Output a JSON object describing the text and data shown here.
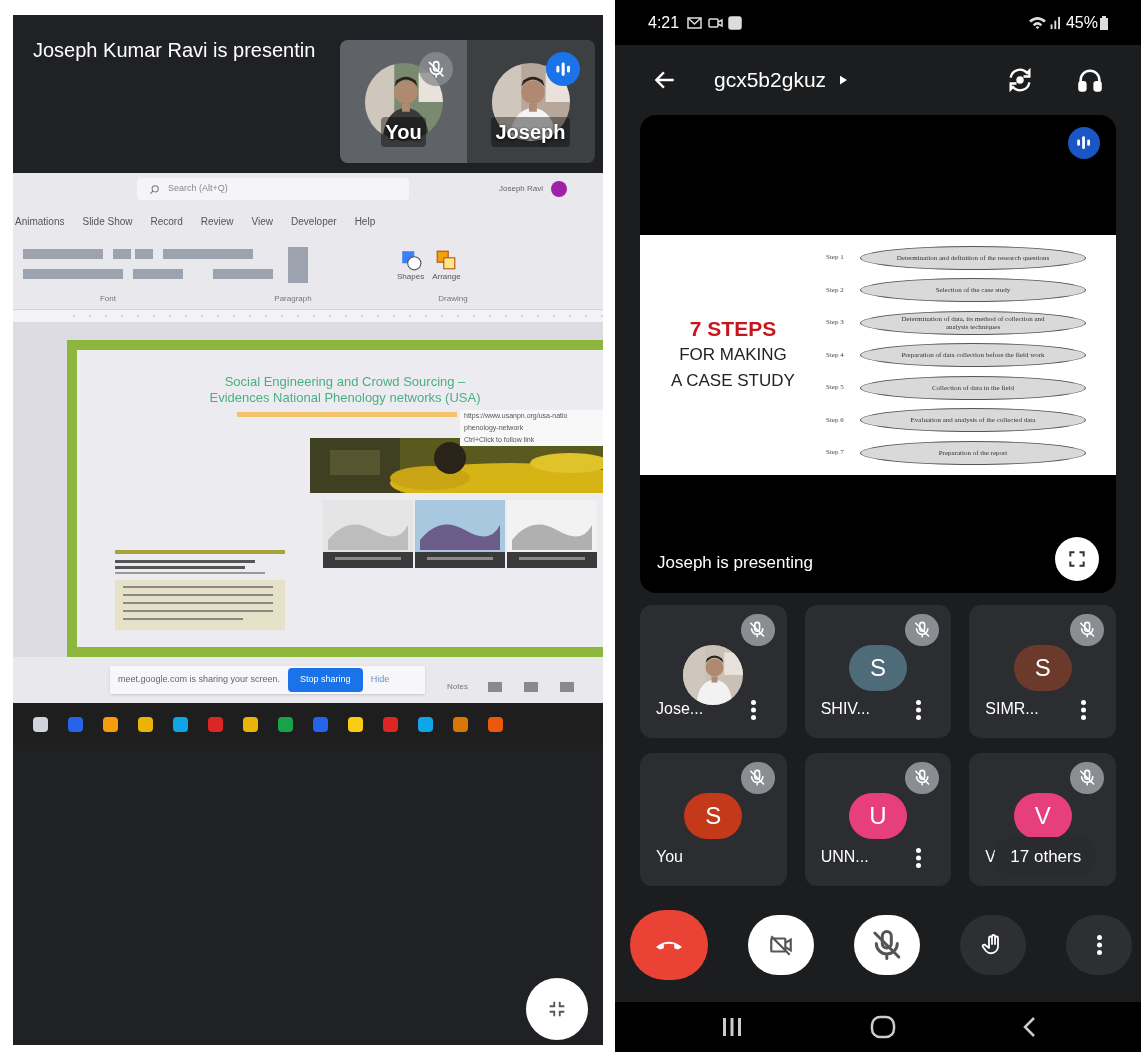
{
  "left_screen": {
    "presenting_banner": "Joseph Kumar Ravi is presentin",
    "self_view": [
      {
        "name": "You",
        "kind": "muted"
      },
      {
        "name": "Joseph",
        "kind": "speaking"
      }
    ],
    "shared_screen": {
      "search_placeholder": "Search (Alt+Q)",
      "account_name": "Joseph Ravi",
      "ribbon_tabs": [
        "Animations",
        "Slide Show",
        "Record",
        "Review",
        "View",
        "Developer",
        "Help"
      ],
      "ribbon_buttons": [
        "Shapes",
        "Arrange"
      ],
      "ribbon_groups": [
        "Font",
        "Paragraph",
        "Drawing"
      ],
      "slide": {
        "title_lines": [
          "Social Engineering and Crowd Sourcing –",
          "Evidences National Phenology networks (USA)"
        ],
        "link_tooltip": [
          "https://www.usanpn.org/usa-natio",
          "phenology-network",
          "Ctrl+Click to follow link"
        ]
      },
      "share_bar": {
        "message": "meet.google.com is sharing your screen.",
        "stop_button": "Stop sharing",
        "hide_button": "Hide"
      },
      "notes_label": "Notes"
    }
  },
  "right_screen": {
    "status_bar": {
      "time": "4:21",
      "battery": "45%"
    },
    "meeting_code": "gcx5b2gkuz",
    "presentation": {
      "speaking": true,
      "caption": "Joseph is presenting",
      "slide": {
        "heading": "7 STEPS",
        "subheading_lines": [
          "FOR MAKING",
          "A CASE STUDY"
        ],
        "steps": [
          {
            "label": "Step 1",
            "text": "Determination and definition of the research questions"
          },
          {
            "label": "Step 2",
            "text": "Selection of the case study"
          },
          {
            "label": "Step 3",
            "text": "Determination of data, its method of collection and analysis techniques"
          },
          {
            "label": "Step 4",
            "text": "Preparation of data collection before the field work"
          },
          {
            "label": "Step 5",
            "text": "Collection of data in the field"
          },
          {
            "label": "Step 6",
            "text": "Evaluation and analysis of the collected data"
          },
          {
            "label": "Step 7",
            "text": "Preparation of the report"
          }
        ]
      }
    },
    "participants": [
      {
        "name": "Jose...",
        "muted": true,
        "menu": true
      },
      {
        "name": "SHIV...",
        "kind": "letter",
        "initial": "S",
        "color": "#4e6b7a",
        "muted": true,
        "menu": true
      },
      {
        "name": "SIMR...",
        "kind": "letter",
        "initial": "S",
        "color": "#6b3a2a",
        "muted": true,
        "menu": true
      },
      {
        "name": "You",
        "kind": "letter",
        "initial": "S",
        "color": "#c4391a",
        "muted": true,
        "menu": false
      },
      {
        "name": "UNN...",
        "kind": "letter",
        "initial": "U",
        "color": "#e63f7b",
        "muted": true,
        "menu": true
      },
      {
        "name": "V",
        "kind": "letter",
        "initial": "V",
        "color": "#e63f7c",
        "muted": true,
        "menu": false
      }
    ],
    "others_chip": "17 others",
    "controls": {
      "camera_on": false,
      "mic_on": false
    }
  }
}
